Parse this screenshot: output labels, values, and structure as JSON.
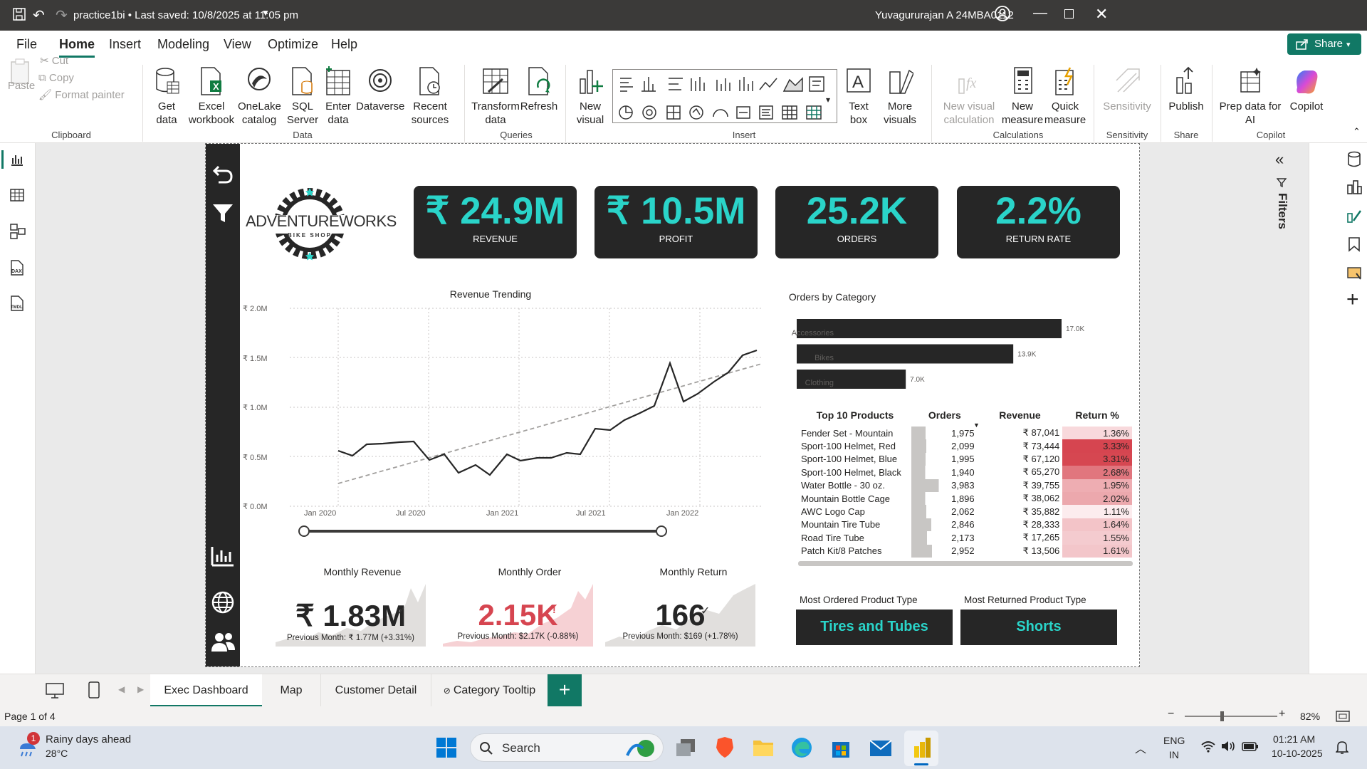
{
  "titlebar": {
    "file_title": "practice1bi • Last saved: 10/8/2025 at 11:05 pm",
    "user": "Yuvagururajan A 24MBA0112"
  },
  "menu": [
    "File",
    "Home",
    "Insert",
    "Modeling",
    "View",
    "Optimize",
    "Help"
  ],
  "share_label": "Share",
  "ribbon": {
    "clipboard": {
      "paste": "Paste",
      "cut": "Cut",
      "copy": "Copy",
      "format_painter": "Format painter",
      "group": "Clipboard"
    },
    "data": {
      "get_data": "Get data",
      "excel": "Excel workbook",
      "onelake": "OneLake catalog",
      "sql": "SQL Server",
      "enter": "Enter data",
      "dataverse": "Dataverse",
      "recent": "Recent sources",
      "group": "Data"
    },
    "queries": {
      "transform": "Transform data",
      "refresh": "Refresh",
      "group": "Queries"
    },
    "insert": {
      "new_visual": "New visual",
      "text_box": "Text box",
      "more_visuals": "More visuals",
      "group": "Insert"
    },
    "calculations": {
      "new_visual_calc": "New visual calculation",
      "new_measure": "New measure",
      "quick_measure": "Quick measure",
      "group": "Calculations"
    },
    "sensitivity": {
      "label": "Sensitivity",
      "group": "Sensitivity"
    },
    "share": {
      "publish": "Publish",
      "group": "Share"
    },
    "copilot": {
      "prep": "Prep data for AI",
      "copilot": "Copilot",
      "group": "Copilot"
    }
  },
  "report": {
    "logo_text": "ADVENTUREWORKS",
    "logo_sub": "BIKE SHOP",
    "kpis": [
      {
        "value": "₹ 24.9M",
        "label": "REVENUE"
      },
      {
        "value": "₹ 10.5M",
        "label": "PROFIT"
      },
      {
        "value": "25.2K",
        "label": "ORDERS"
      },
      {
        "value": "2.2%",
        "label": "RETURN RATE"
      }
    ],
    "revenue_trending": {
      "title": "Revenue Trending",
      "y_ticks": [
        "₹ 2.0M",
        "₹ 1.5M",
        "₹ 1.0M",
        "₹ 0.5M",
        "₹ 0.0M"
      ],
      "x_ticks": [
        "Jan 2020",
        "Jul 2020",
        "Jan 2021",
        "Jul 2021",
        "Jan 2022"
      ]
    },
    "orders_by_category": {
      "title": "Orders by Category",
      "bars": [
        {
          "label": "Accessories",
          "value_label": "17.0K",
          "value": 17.0
        },
        {
          "label": "Bikes",
          "value_label": "13.9K",
          "value": 13.9
        },
        {
          "label": "Clothing",
          "value_label": "7.0K",
          "value": 7.0
        }
      ]
    },
    "top_products": {
      "headers": [
        "Top 10 Products",
        "Orders",
        "Revenue",
        "Return %"
      ],
      "rows": [
        [
          "Fender Set - Mountain",
          "1,975",
          "₹ 87,041",
          "1.36%"
        ],
        [
          "Sport-100 Helmet, Red",
          "2,099",
          "₹ 73,444",
          "3.33%"
        ],
        [
          "Sport-100 Helmet, Blue",
          "1,995",
          "₹ 67,120",
          "3.31%"
        ],
        [
          "Sport-100 Helmet, Black",
          "1,940",
          "₹ 65,270",
          "2.68%"
        ],
        [
          "Water Bottle - 30 oz.",
          "3,983",
          "₹ 39,755",
          "1.95%"
        ],
        [
          "Mountain Bottle Cage",
          "1,896",
          "₹ 38,062",
          "2.02%"
        ],
        [
          "AWC Logo Cap",
          "2,062",
          "₹ 35,882",
          "1.11%"
        ],
        [
          "Mountain Tire Tube",
          "2,846",
          "₹ 28,333",
          "1.64%"
        ],
        [
          "Road Tire Tube",
          "2,173",
          "₹ 17,265",
          "1.55%"
        ],
        [
          "Patch Kit/8 Patches",
          "2,952",
          "₹ 13,506",
          "1.61%"
        ]
      ]
    },
    "monthly_revenue": {
      "title": "Monthly Revenue",
      "value": "₹ 1.83M",
      "sub": "Previous Month: ₹ 1.77M (+3.31%)"
    },
    "monthly_order": {
      "title": "Monthly Order",
      "value": "2.15K",
      "sub": "Previous Month: $2.17K (-0.88%)"
    },
    "monthly_return": {
      "title": "Monthly Return",
      "value": "166",
      "sub": "Previous Month: $169 (+1.78%)"
    },
    "most_ordered": {
      "title": "Most Ordered Product Type",
      "value": "Tires and Tubes"
    },
    "most_returned": {
      "title": "Most Returned Product Type",
      "value": "Shorts"
    }
  },
  "right_panel": {
    "filters": "Filters"
  },
  "tabs": [
    "Exec Dashboard",
    "Map",
    "Customer Detail",
    "Category Tooltip"
  ],
  "status": {
    "page": "Page 1 of 4",
    "zoom": "82%"
  },
  "taskbar": {
    "weather_title": "Rainy days ahead",
    "weather_temp": "28°C",
    "weather_badge": "1",
    "search": "Search",
    "lang1": "ENG",
    "lang2": "IN",
    "time": "01:21 AM",
    "date": "10-10-2025"
  },
  "colors": {
    "accent": "#117865",
    "kpi_text": "#2ad4c9",
    "dark": "#262626",
    "negative": "#d64550"
  }
}
